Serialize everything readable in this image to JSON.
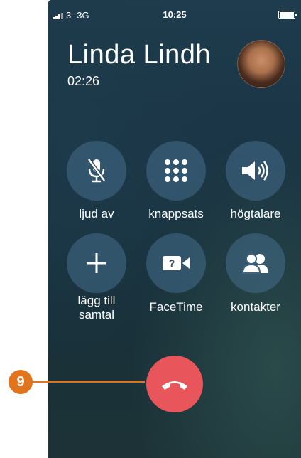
{
  "status_bar": {
    "carrier": "3",
    "network": "3G",
    "time": "10:25",
    "battery_level": 1.0
  },
  "call": {
    "name": "Linda Lindh",
    "duration": "02:26"
  },
  "buttons": [
    {
      "label": "ljud av",
      "icon": "mic-off-icon"
    },
    {
      "label": "knappsats",
      "icon": "keypad-icon"
    },
    {
      "label": "högtalare",
      "icon": "speaker-icon"
    },
    {
      "label_line1": "lägg till",
      "label_line2": "samtal",
      "icon": "plus-icon"
    },
    {
      "label": "FaceTime",
      "icon": "facetime-icon"
    },
    {
      "label": "kontakter",
      "icon": "contacts-icon"
    }
  ],
  "end_call": {
    "icon": "end-call-icon",
    "color": "#e8555a"
  },
  "callout": {
    "number": "9",
    "color": "#e0741f"
  }
}
